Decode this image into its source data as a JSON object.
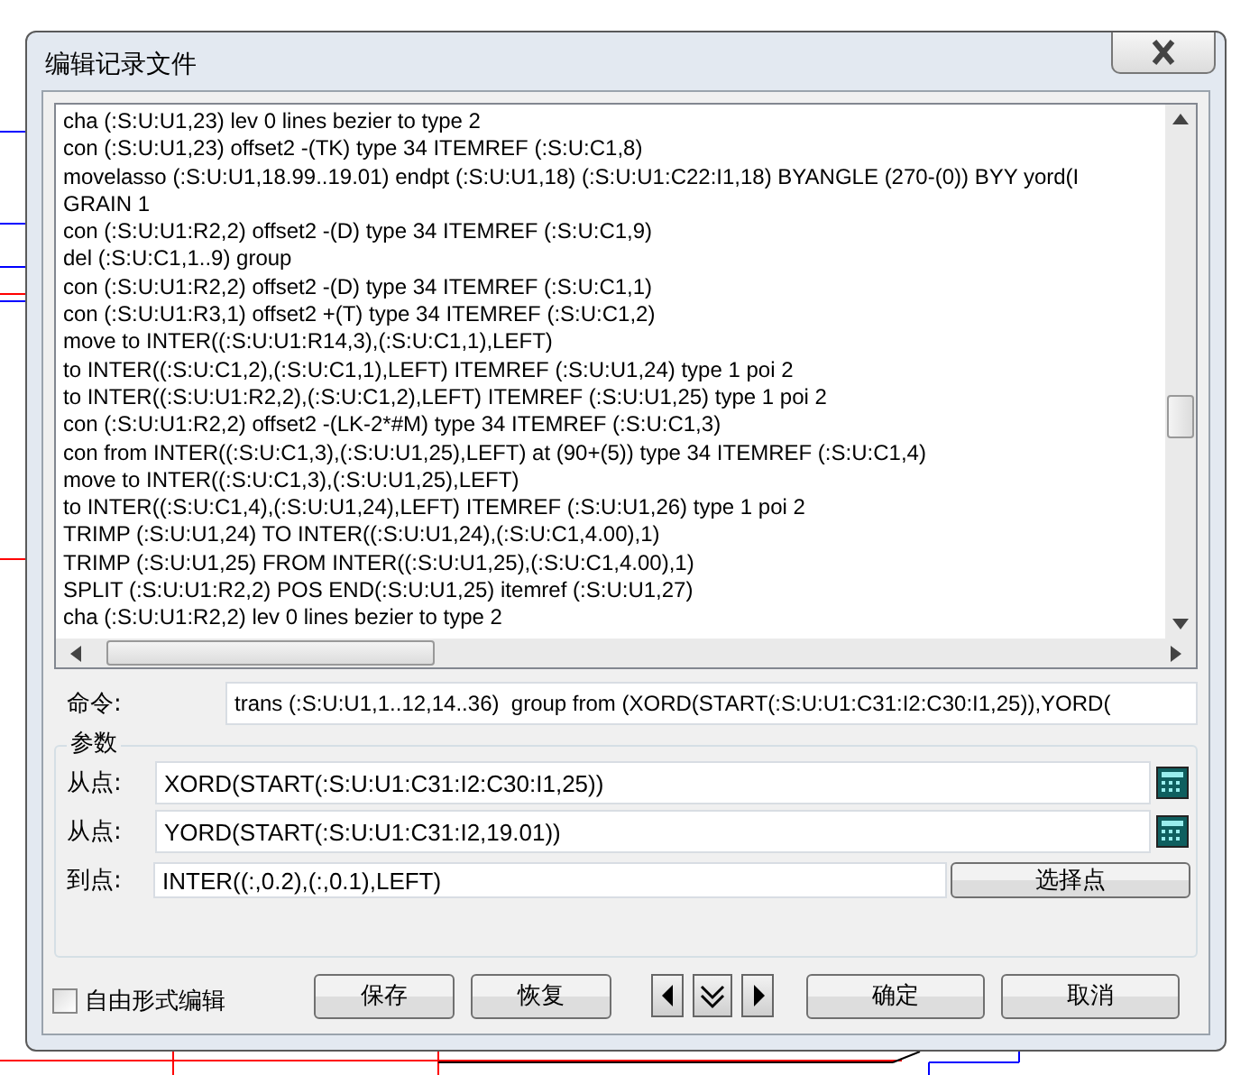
{
  "window": {
    "title": "编辑记录文件"
  },
  "log_lines": [
    "cha (:S:U:U1,23) lev 0 lines bezier to type 2",
    "con (:S:U:U1,23) offset2 -(TK) type 34 ITEMREF (:S:U:C1,8)",
    "movelasso (:S:U:U1,18.99..19.01) endpt (:S:U:U1,18) (:S:U:U1:C22:I1,18) BYANGLE (270-(0)) BYY yord(I",
    "GRAIN 1",
    "con (:S:U:U1:R2,2) offset2 -(D) type 34 ITEMREF (:S:U:C1,9)",
    "del (:S:U:C1,1..9) group",
    "con (:S:U:U1:R2,2) offset2 -(D) type 34 ITEMREF (:S:U:C1,1)",
    "con (:S:U:U1:R3,1) offset2 +(T) type 34 ITEMREF (:S:U:C1,2)",
    "move to INTER((:S:U:U1:R14,3),(:S:U:C1,1),LEFT)",
    "to INTER((:S:U:C1,2),(:S:U:C1,1),LEFT) ITEMREF (:S:U:U1,24) type 1 poi 2",
    "to INTER((:S:U:U1:R2,2),(:S:U:C1,2),LEFT) ITEMREF (:S:U:U1,25) type 1 poi 2",
    "con (:S:U:U1:R2,2) offset2 -(LK-2*#M) type 34 ITEMREF (:S:U:C1,3)",
    "con from INTER((:S:U:C1,3),(:S:U:U1,25),LEFT) at (90+(5)) type 34 ITEMREF (:S:U:C1,4)",
    "move to INTER((:S:U:C1,3),(:S:U:U1,25),LEFT)",
    "to INTER((:S:U:C1,4),(:S:U:U1,24),LEFT) ITEMREF (:S:U:U1,26) type 1 poi 2",
    "TRIMP (:S:U:U1,24) TO INTER((:S:U:U1,24),(:S:U:C1,4.00),1)",
    "TRIMP (:S:U:U1,25) FROM INTER((:S:U:U1,25),(:S:U:C1,4.00),1)",
    "SPLIT (:S:U:U1:R2,2) POS END(:S:U:U1,25) itemref (:S:U:U1,27)",
    "cha (:S:U:U1:R2,2) lev 0 lines bezier to type 2"
  ],
  "command": {
    "label": "命令:",
    "value": "trans (:S:U:U1,1..12,14..36)  group from (XORD(START(:S:U:U1:C31:I2:C30:I1,25)),YORD("
  },
  "params": {
    "legend": "参数",
    "rows": [
      {
        "kind": "calc",
        "label": "从点:",
        "value": "XORD(START(:S:U:U1:C31:I2:C30:I1,25))"
      },
      {
        "kind": "calc",
        "label": "从点:",
        "value": "YORD(START(:S:U:U1:C31:I2,19.01))"
      },
      {
        "kind": "pick",
        "label": "到点:",
        "value": "INTER((:,0.2),(:,0.1),LEFT)",
        "button": "选择点"
      }
    ]
  },
  "free_form": {
    "label": "自由形式编辑",
    "checked": false
  },
  "buttons": [
    "保存",
    "恢复"
  ],
  "nav": [
    {
      "kind": "prev"
    },
    {
      "kind": "down"
    },
    {
      "kind": "next"
    }
  ],
  "actions": [
    "确定",
    "取消"
  ]
}
